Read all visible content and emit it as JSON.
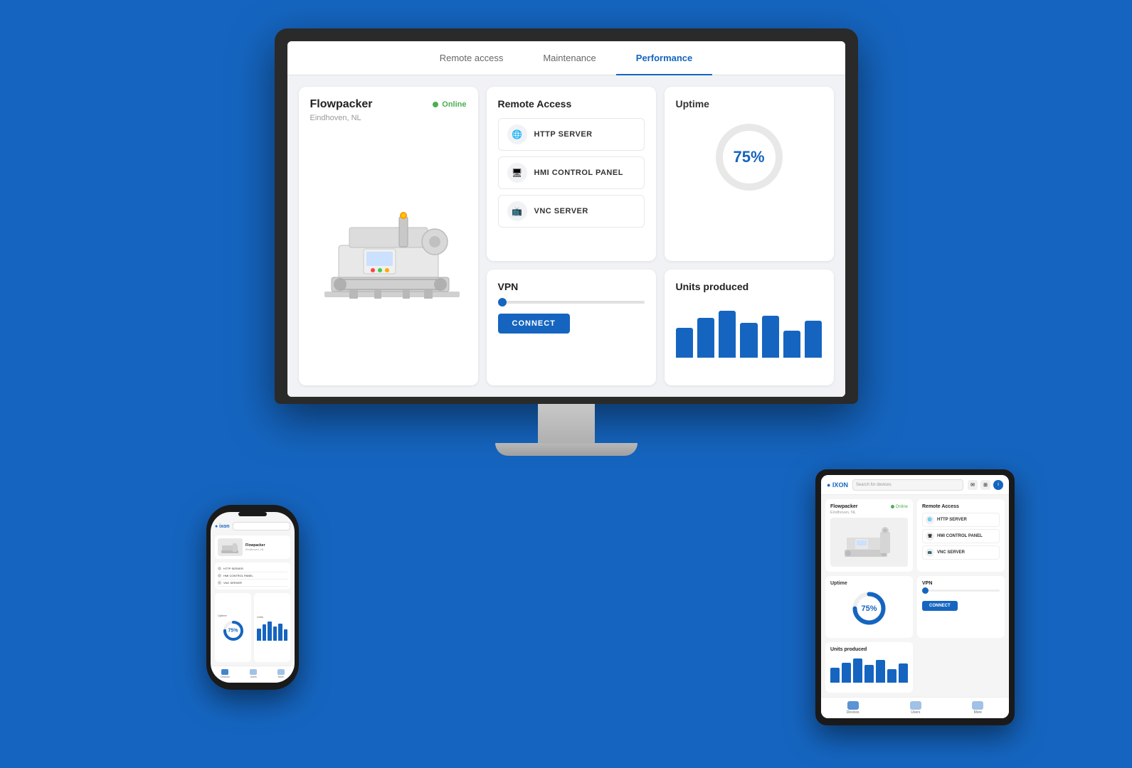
{
  "app": {
    "name": "IXON",
    "background_color": "#1565C0"
  },
  "monitor": {
    "nav": {
      "tabs": [
        {
          "id": "remote-access",
          "label": "Remote access",
          "active": false
        },
        {
          "id": "maintenance",
          "label": "Maintenance",
          "active": false
        },
        {
          "id": "performance",
          "label": "Performance",
          "active": true
        }
      ]
    },
    "machine_card": {
      "name": "Flowpacker",
      "location": "Eindhoven, NL",
      "status": "Online"
    },
    "remote_access": {
      "title": "Remote Access",
      "items": [
        {
          "label": "HTTP SERVER",
          "icon": "globe"
        },
        {
          "label": "HMI CONTROL PANEL",
          "icon": "monitor"
        },
        {
          "label": "VNC SERVER",
          "icon": "display"
        }
      ]
    },
    "vpn": {
      "title": "VPN",
      "connect_label": "CONNECT"
    },
    "uptime": {
      "title": "Uptime",
      "value": "75%",
      "percentage": 75
    },
    "units_produced": {
      "title": "Units produced",
      "bars": [
        60,
        80,
        95,
        70,
        85,
        55,
        75
      ]
    }
  },
  "phone": {
    "logo": "ixon",
    "machine_name": "Flowpacker",
    "machine_loc": "Eindhoven, NL",
    "uptime_value": "75%",
    "uptime_pct": 75,
    "bars": [
      60,
      80,
      95,
      70,
      85,
      55,
      75
    ],
    "remote_items": [
      "HTTP SERVER",
      "HMI CONTROL PANEL",
      "VNC SERVER"
    ],
    "tabs": [
      "Devices",
      "Users",
      "More"
    ]
  },
  "tablet": {
    "logo": "IXON",
    "search_placeholder": "Search for devices",
    "machine_name": "Flowpacker",
    "machine_loc": "Eindhoven, NL",
    "status": "Online",
    "uptime_value": "75%",
    "uptime_pct": 75,
    "bars": [
      55,
      75,
      90,
      65,
      85,
      50,
      70
    ],
    "connect_label": "CONNECT",
    "remote_items": [
      "HTTP SERVER",
      "HMI CONTROL PANEL",
      "VNC SERVER"
    ],
    "bottom_tabs": [
      "Devices",
      "Users",
      "More"
    ]
  }
}
